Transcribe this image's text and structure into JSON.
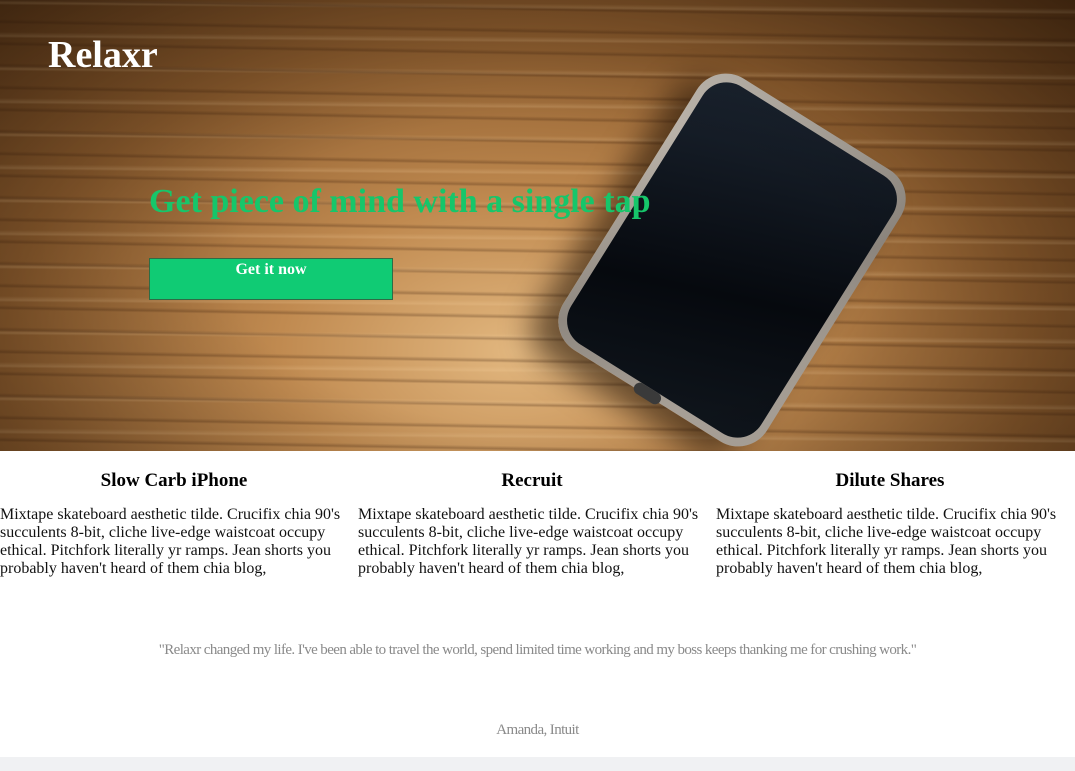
{
  "brand": {
    "name": "Relaxr"
  },
  "hero": {
    "headline": "Get piece of mind with a single tap",
    "cta_label": "Get it now"
  },
  "features": [
    {
      "title": "Slow Carb iPhone",
      "body": "Mixtape skateboard aesthetic tilde. Crucifix chia 90's succulents 8-bit, cliche live-edge waistcoat occupy ethical. Pitchfork literally yr ramps. Jean shorts you probably haven't heard of them chia blog,"
    },
    {
      "title": "Recruit",
      "body": "Mixtape skateboard aesthetic tilde. Crucifix chia 90's succulents 8-bit, cliche live-edge waistcoat occupy ethical. Pitchfork literally yr ramps. Jean shorts you probably haven't heard of them chia blog,"
    },
    {
      "title": "Dilute Shares",
      "body": "Mixtape skateboard aesthetic tilde. Crucifix chia 90's succulents 8-bit, cliche live-edge waistcoat occupy ethical. Pitchfork literally yr ramps. Jean shorts you probably haven't heard of them chia blog,"
    }
  ],
  "testimonial": {
    "quote": "\"Relaxr changed my life. I've been able to travel the world, spend limited time working and my boss keeps thanking me for crushing work.\"",
    "attribution": "Amanda, Intuit"
  },
  "colors": {
    "accent": "#10cb74",
    "headline": "#16c66a",
    "muted_text": "#8a8a8a"
  },
  "images": {
    "hero_background": "wood-table-with-smartphone"
  }
}
